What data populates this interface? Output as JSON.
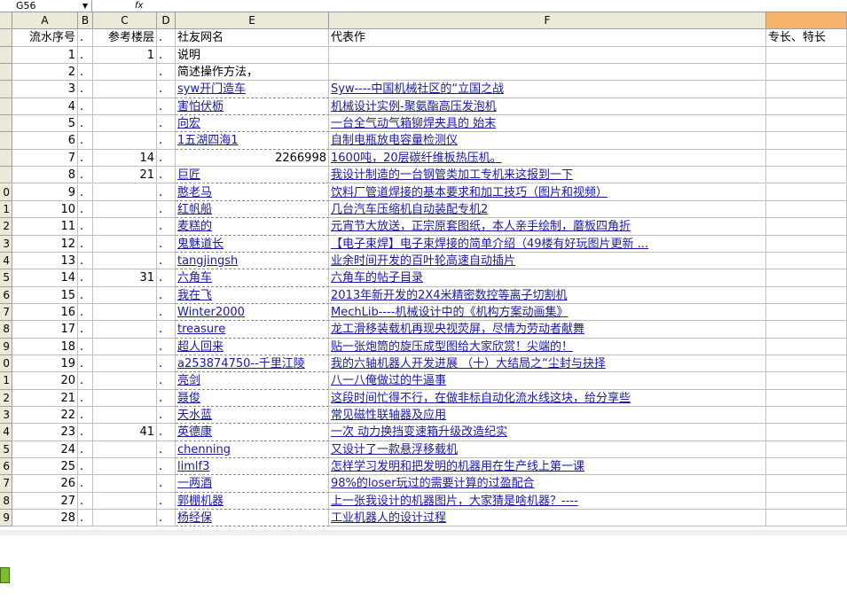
{
  "formula_bar": {
    "name_box": "G56",
    "fx_label": "fx"
  },
  "columns": {
    "rowhdr": "",
    "A": "A",
    "B": "B",
    "C": "C",
    "D": "D",
    "E": "E",
    "F": "F",
    "G": ""
  },
  "header_row": {
    "rownum": "",
    "a": "流水序号",
    "b": ".",
    "c": "参考楼层",
    "d": ".",
    "e": "社友网名",
    "f": "代表作",
    "g": "专长、特长"
  },
  "rows": [
    {
      "rownum": "",
      "a": "1",
      "b": ".",
      "c": "1",
      "d": ".",
      "e": "说明",
      "f": ""
    },
    {
      "rownum": "",
      "a": "2",
      "b": ".",
      "c": "",
      "d": ".",
      "e": "简述操作方法，",
      "f": ""
    },
    {
      "rownum": "",
      "a": "3",
      "b": ".",
      "c": "",
      "d": ".",
      "e": "syw开门造车",
      "f": "Syw----中国机械社区的“立国之战"
    },
    {
      "rownum": "",
      "a": "4",
      "b": ".",
      "c": "",
      "d": ".",
      "e": "害怕伏枥",
      "f": "机械设计实例-聚氨酯高压发泡机"
    },
    {
      "rownum": "",
      "a": "5",
      "b": ".",
      "c": "",
      "d": ".",
      "e": "向宏",
      "f": "一台全气动气箱铆焊夹具的 始末"
    },
    {
      "rownum": "",
      "a": "6",
      "b": ".",
      "c": "",
      "d": ".",
      "e": "1五湖四海1",
      "f": "自制电瓶放电容量检测仪"
    },
    {
      "rownum": "",
      "a": "7",
      "b": ".",
      "c": "14",
      "d": ".",
      "e": "2266998",
      "f": "1600吨，20层碳纤维板热压机。"
    },
    {
      "rownum": "",
      "a": "8",
      "b": ".",
      "c": "21",
      "d": ".",
      "e": "巨匠",
      "f": "我设计制造的一台钢管类加工专机来这报到一下"
    },
    {
      "rownum": "0",
      "a": "9",
      "b": ".",
      "c": "",
      "d": ".",
      "e": "憨老马",
      "f": "饮料厂管道焊接的基本要求和加工技巧（图片和视频）"
    },
    {
      "rownum": "1",
      "a": "10",
      "b": ".",
      "c": "",
      "d": ".",
      "e": "红帆船",
      "f": "几台汽车压缩机自动装配专机2"
    },
    {
      "rownum": "2",
      "a": "11",
      "b": ".",
      "c": "",
      "d": ".",
      "e": "麦糕的",
      "f": "元宵节大放送，正宗原套图纸，本人亲手绘制，蘑板四角折"
    },
    {
      "rownum": "3",
      "a": "12",
      "b": ".",
      "c": "",
      "d": ".",
      "e": "鬼魅道长",
      "f": "【电子束焊】电子束焊接的简单介绍（49楼有好玩图片更新 ..."
    },
    {
      "rownum": "4",
      "a": "13",
      "b": ".",
      "c": "",
      "d": ".",
      "e": "tangjingsh",
      "f": "业余时间开发的百叶轮高速自动插片"
    },
    {
      "rownum": "5",
      "a": "14",
      "b": ".",
      "c": "31",
      "d": ".",
      "e": "六角车",
      "f": "六角车的帖子目录"
    },
    {
      "rownum": "6",
      "a": "15",
      "b": ".",
      "c": "",
      "d": ".",
      "e": "我在飞",
      "f": "2013年新开发的2X4米精密数控等离子切割机"
    },
    {
      "rownum": "7",
      "a": "16",
      "b": ".",
      "c": "",
      "d": ".",
      "e": "Winter2000",
      "f": "MechLib----机械设计中的《机构方案动画集》"
    },
    {
      "rownum": "8",
      "a": "17",
      "b": ".",
      "c": "",
      "d": ".",
      "e": "treasure",
      "f": "龙工滑移装载机再现央视荧屏，尽情为劳动者献舞"
    },
    {
      "rownum": "9",
      "a": "18",
      "b": ".",
      "c": "",
      "d": ".",
      "e": "超人回来",
      "f": "贴一张炮筒的旋压成型图给大家欣赏！尖端的！"
    },
    {
      "rownum": "0",
      "a": "19",
      "b": ".",
      "c": "",
      "d": ".",
      "e": "a253874750--千里江陵",
      "f": "我的六轴机器人开发进展 （十）大结局之“尘封与抉择"
    },
    {
      "rownum": "1",
      "a": "20",
      "b": ".",
      "c": "",
      "d": ".",
      "e": "亮剑",
      "f": "八一八俺做过的牛逼事"
    },
    {
      "rownum": "2",
      "a": "21",
      "b": ".",
      "c": "",
      "d": ".",
      "e": "聂俊",
      "f": "这段时间忙得不行，在做非标自动化流水线这块，给分享些"
    },
    {
      "rownum": "3",
      "a": "22",
      "b": ".",
      "c": "",
      "d": ".",
      "e": "天水蓝",
      "f": "常见磁性联轴器及应用"
    },
    {
      "rownum": "4",
      "a": "23",
      "b": ".",
      "c": "41",
      "d": ".",
      "e": "英德康",
      "f": "一次 动力换挡变速箱升级改造纪实"
    },
    {
      "rownum": "5",
      "a": "24",
      "b": ".",
      "c": "",
      "d": ".",
      "e": "chenning",
      "f": "又设计了一款悬浮移载机"
    },
    {
      "rownum": "6",
      "a": "25",
      "b": ".",
      "c": "",
      "d": ".",
      "e": "limlf3",
      "f": "怎样学习发明和把发明的机器用在生产线上第一课"
    },
    {
      "rownum": "7",
      "a": "26",
      "b": ".",
      "c": "",
      "d": ".",
      "e": "一两酒",
      "f": "98%的loser玩过的需要计算的过盈配合"
    },
    {
      "rownum": "8",
      "a": "27",
      "b": ".",
      "c": "",
      "d": ".",
      "e": "郭棚机器",
      "f": "上一张我设计的机器图片，大家猜是啥机器？----"
    },
    {
      "rownum": "9",
      "a": "28",
      "b": ".",
      "c": "",
      "d": ".",
      "e": "杨经保",
      "f": "工业机器人的设计过程"
    }
  ]
}
